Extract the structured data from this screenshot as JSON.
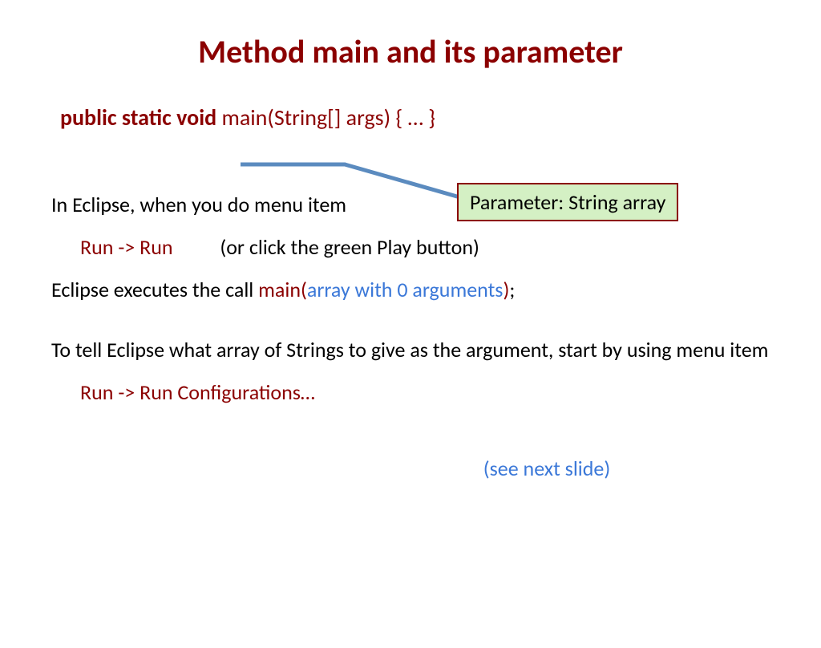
{
  "title": "Method main and its parameter",
  "code": {
    "keywords": "public static void",
    "rest": " main(String[] args) { … }"
  },
  "callout": "Parameter: String array",
  "p1": "In Eclipse, when you do menu item",
  "p2": {
    "menu": "Run -> Run",
    "rest": "(or click the green Play button)"
  },
  "p3": {
    "a": "Eclipse executes the call ",
    "b": "main(",
    "c": "array with 0 arguments",
    "d": ")",
    "e": ";"
  },
  "p4": "To tell Eclipse what array of Strings to give as the argument, start by using menu item",
  "p5": "Run -> Run Configurations…",
  "p6": "(see next slide)"
}
